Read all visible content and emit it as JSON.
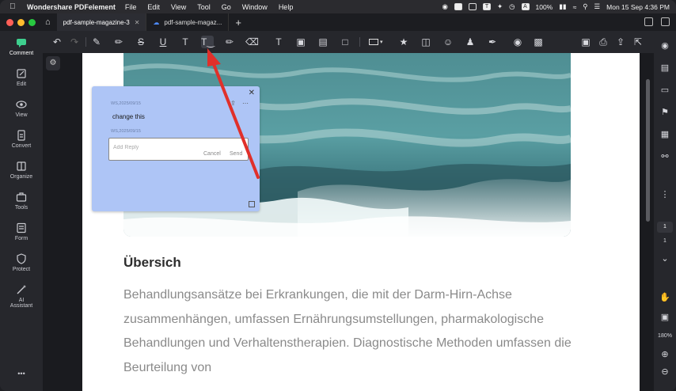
{
  "menubar": {
    "app_name": "Wondershare PDFelement",
    "items": [
      "File",
      "Edit",
      "View",
      "Tool",
      "Go",
      "Window",
      "Help"
    ],
    "battery": "100%",
    "datetime": "Mon 15 Sep  4:36 PM"
  },
  "tabs": [
    {
      "label": "pdf-sample-magazine-3",
      "active": true
    },
    {
      "label": "pdf-sample-magaz...",
      "active": false
    }
  ],
  "sidebar": {
    "items": [
      {
        "label": "Comment",
        "icon": "comment-icon",
        "active": true
      },
      {
        "label": "Edit",
        "icon": "edit-icon"
      },
      {
        "label": "View",
        "icon": "eye-icon"
      },
      {
        "label": "Convert",
        "icon": "convert-icon"
      },
      {
        "label": "Organize",
        "icon": "organize-icon"
      },
      {
        "label": "Tools",
        "icon": "toolbox-icon"
      },
      {
        "label": "Form",
        "icon": "form-icon"
      },
      {
        "label": "Protect",
        "icon": "shield-icon"
      },
      {
        "label": "AI",
        "icon": "ai-wand-icon"
      },
      {
        "label": "Assistant",
        "icon": ""
      }
    ],
    "more": "•••"
  },
  "comment_popup": {
    "author_date_1": "WS,2025/09/15",
    "comment_text": "change this",
    "author_date_2": "WS,2025/09/15",
    "reply_placeholder": "Add Reply",
    "cancel_label": "Cancel",
    "send_label": "Send"
  },
  "document": {
    "heading": "Übersich",
    "paragraph": "Behandlungsansätze bei Erkrankungen, die mit der Darm-Hirn-Achse zusammenhängen, umfassen Ernährungsumstellungen, pharmakologische Behandlungen und Verhaltenstherapien. Diagnostische Methoden umfassen die Beurteilung von"
  },
  "right_rail": {
    "page_current": "1",
    "page_total": "1",
    "zoom": "180%"
  },
  "colors": {
    "popup_bg": "#aec5f6",
    "accent_arrow": "#e0302a",
    "traffic_red": "#ff5f57",
    "traffic_yellow": "#febc2e",
    "traffic_green": "#28c840"
  }
}
